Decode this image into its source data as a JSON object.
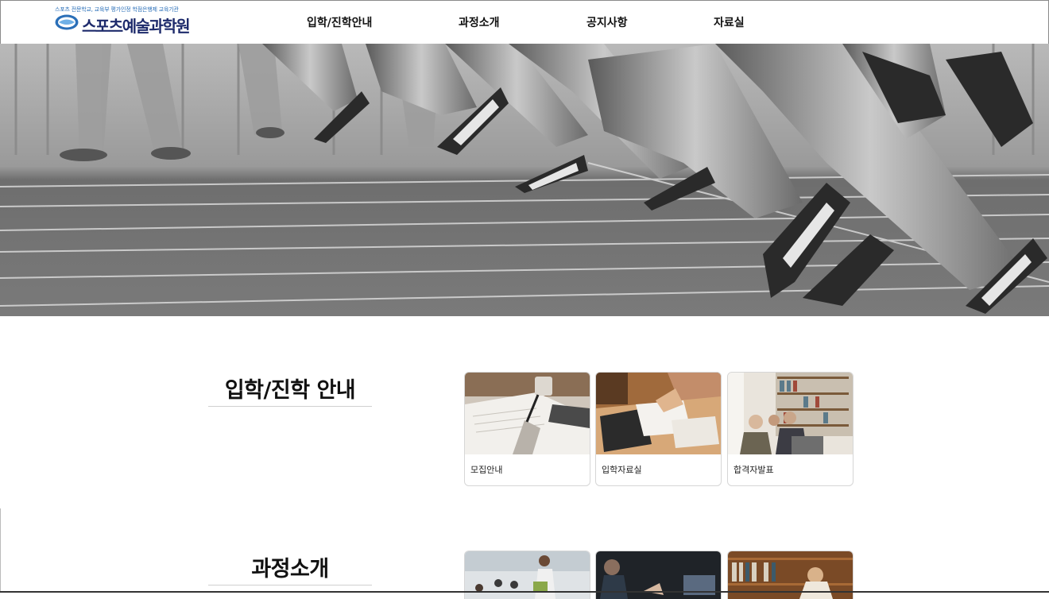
{
  "header": {
    "logo_tagline": "스포츠 전문학교, 교육부 평가인정 학점은행제 교육기관",
    "logo_name": "스포츠예술과학원",
    "nav": [
      {
        "label": "입학/진학안내"
      },
      {
        "label": "과정소개"
      },
      {
        "label": "공지사항"
      },
      {
        "label": "자료실"
      }
    ]
  },
  "sections": [
    {
      "title": "입학/진학 안내",
      "cards": [
        {
          "label": "모집안내"
        },
        {
          "label": "입학자료실"
        },
        {
          "label": "합격자발표"
        }
      ]
    },
    {
      "title": "과정소개",
      "cards": []
    }
  ],
  "colors": {
    "logo_text": "#1d2a6b",
    "logo_accent": "#2a6fb8"
  }
}
